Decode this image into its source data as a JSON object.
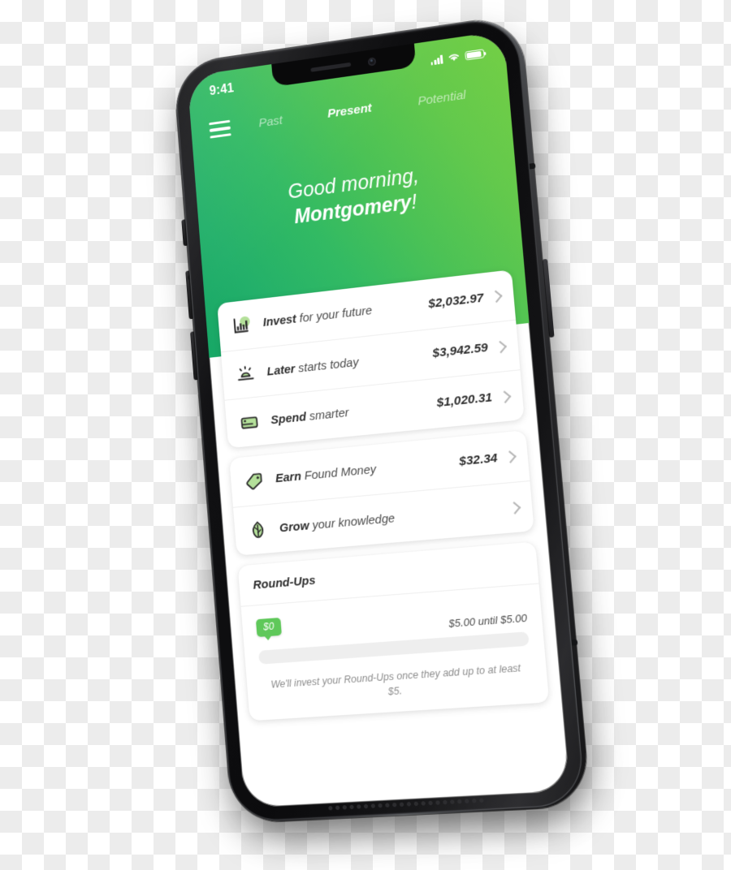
{
  "status_bar": {
    "time": "9:41",
    "signal_icon": "cellular-signal-icon",
    "wifi_icon": "wifi-icon",
    "battery_icon": "battery-full-icon"
  },
  "nav": {
    "menu_icon": "hamburger-menu-icon",
    "tabs": [
      {
        "label": "Past",
        "active": false
      },
      {
        "label": "Present",
        "active": true
      },
      {
        "label": "Potential",
        "active": false
      }
    ]
  },
  "greeting": {
    "line1": "Good morning,",
    "name": "Montgomery",
    "punctuation": "!"
  },
  "accounts_card": {
    "rows": [
      {
        "icon": "bar-chart-icon",
        "label_bold": "Invest",
        "label_rest": " for your future",
        "amount": "$2,032.97",
        "chevron": "chevron-right-icon"
      },
      {
        "icon": "sunrise-icon",
        "label_bold": "Later",
        "label_rest": " starts today",
        "amount": "$3,942.59",
        "chevron": "chevron-right-icon"
      },
      {
        "icon": "credit-card-icon",
        "label_bold": "Spend",
        "label_rest": " smarter",
        "amount": "$1,020.31",
        "chevron": "chevron-right-icon"
      }
    ]
  },
  "secondary_card": {
    "rows": [
      {
        "icon": "price-tag-icon",
        "label_bold": "Earn",
        "label_rest": " Found Money",
        "amount": "$32.34",
        "chevron": "chevron-right-icon"
      },
      {
        "icon": "leaf-icon",
        "label_bold": "Grow",
        "label_rest": " your knowledge",
        "amount": "",
        "chevron": "chevron-right-icon"
      }
    ]
  },
  "round_ups": {
    "title": "Round-Ups",
    "badge_amount": "$0",
    "goal_text": "$5.00 until $5.00",
    "progress_percent": 0,
    "note": "We'll invest your Round-Ups once they add up to at least $5."
  },
  "colors": {
    "gradient_start": "#17a766",
    "gradient_end": "#74cf45",
    "accent_green": "#5fc85a",
    "icon_green": "#b4e09a",
    "text_dark": "#2d2d2d",
    "text_muted": "#8d8d8d"
  }
}
